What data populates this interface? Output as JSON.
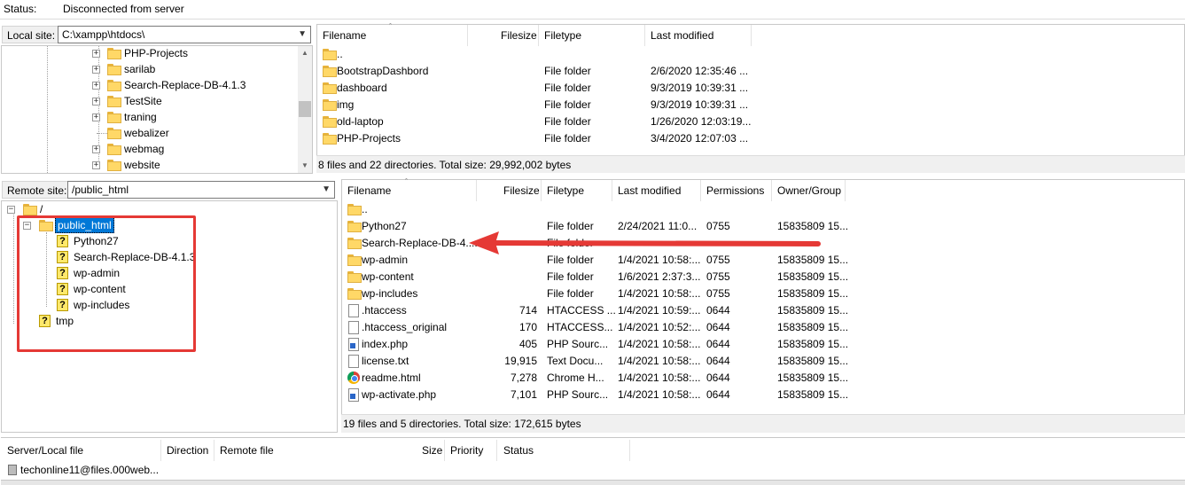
{
  "status_bar": {
    "label": "Status:",
    "message": "Disconnected from server"
  },
  "local": {
    "site_label": "Local site:",
    "site_path": "C:\\xampp\\htdocs\\",
    "tree": [
      "PHP-Projects",
      "sarilab",
      "Search-Replace-DB-4.1.3",
      "TestSite",
      "traning",
      "webalizer",
      "webmag",
      "website"
    ],
    "columns": [
      "Filename",
      "Filesize",
      "Filetype",
      "Last modified"
    ],
    "rows": [
      {
        "name": "..",
        "size": "",
        "type": "",
        "modified": ""
      },
      {
        "name": "BootstrapDashbord",
        "size": "",
        "type": "File folder",
        "modified": "2/6/2020 12:35:46 ..."
      },
      {
        "name": "dashboard",
        "size": "",
        "type": "File folder",
        "modified": "9/3/2019 10:39:31 ..."
      },
      {
        "name": "img",
        "size": "",
        "type": "File folder",
        "modified": "9/3/2019 10:39:31 ..."
      },
      {
        "name": "old-laptop",
        "size": "",
        "type": "File folder",
        "modified": "1/26/2020 12:03:19..."
      },
      {
        "name": "PHP-Projects",
        "size": "",
        "type": "File folder",
        "modified": "3/4/2020 12:07:03 ..."
      }
    ],
    "summary": "8 files and 22 directories. Total size: 29,992,002 bytes"
  },
  "remote": {
    "site_label": "Remote site:",
    "site_path": "/public_html",
    "tree_root": "/",
    "tree_selected": "public_html",
    "tree_children": [
      "Python27",
      "Search-Replace-DB-4.1.3",
      "wp-admin",
      "wp-content",
      "wp-includes"
    ],
    "tree_other": "tmp",
    "columns": [
      "Filename",
      "Filesize",
      "Filetype",
      "Last modified",
      "Permissions",
      "Owner/Group"
    ],
    "rows": [
      {
        "name": "..",
        "size": "",
        "type": "",
        "modified": "",
        "perm": "",
        "owner": "",
        "icon": "folder"
      },
      {
        "name": "Python27",
        "size": "",
        "type": "File folder",
        "modified": "2/24/2021 11:0...",
        "perm": "0755",
        "owner": "15835809 15...",
        "icon": "folder"
      },
      {
        "name": "Search-Replace-DB-4....",
        "size": "",
        "type": "File folder",
        "modified": "",
        "perm": "",
        "owner": "",
        "icon": "folder"
      },
      {
        "name": "wp-admin",
        "size": "",
        "type": "File folder",
        "modified": "1/4/2021 10:58:...",
        "perm": "0755",
        "owner": "15835809 15...",
        "icon": "folder"
      },
      {
        "name": "wp-content",
        "size": "",
        "type": "File folder",
        "modified": "1/6/2021 2:37:3...",
        "perm": "0755",
        "owner": "15835809 15...",
        "icon": "folder"
      },
      {
        "name": "wp-includes",
        "size": "",
        "type": "File folder",
        "modified": "1/4/2021 10:58:...",
        "perm": "0755",
        "owner": "15835809 15...",
        "icon": "folder"
      },
      {
        "name": ".htaccess",
        "size": "714",
        "type": "HTACCESS ...",
        "modified": "1/4/2021 10:59:...",
        "perm": "0644",
        "owner": "15835809 15...",
        "icon": "file"
      },
      {
        "name": ".htaccess_original",
        "size": "170",
        "type": "HTACCESS...",
        "modified": "1/4/2021 10:52:...",
        "perm": "0644",
        "owner": "15835809 15...",
        "icon": "file"
      },
      {
        "name": "index.php",
        "size": "405",
        "type": "PHP Sourc...",
        "modified": "1/4/2021 10:58:...",
        "perm": "0644",
        "owner": "15835809 15...",
        "icon": "php"
      },
      {
        "name": "license.txt",
        "size": "19,915",
        "type": "Text Docu...",
        "modified": "1/4/2021 10:58:...",
        "perm": "0644",
        "owner": "15835809 15...",
        "icon": "file"
      },
      {
        "name": "readme.html",
        "size": "7,278",
        "type": "Chrome H...",
        "modified": "1/4/2021 10:58:...",
        "perm": "0644",
        "owner": "15835809 15...",
        "icon": "chrome"
      },
      {
        "name": "wp-activate.php",
        "size": "7,101",
        "type": "PHP Sourc...",
        "modified": "1/4/2021 10:58:...",
        "perm": "0644",
        "owner": "15835809 15...",
        "icon": "php"
      }
    ],
    "summary": "19 files and 5 directories. Total size: 172,615 bytes"
  },
  "queue": {
    "columns": [
      "Server/Local file",
      "Direction",
      "Remote file",
      "Size",
      "Priority",
      "Status"
    ],
    "item": "techonline11@files.000web..."
  },
  "colors": {
    "selection": "#0078d7",
    "highlight_box": "#e53935",
    "arrow": "#e53935"
  }
}
